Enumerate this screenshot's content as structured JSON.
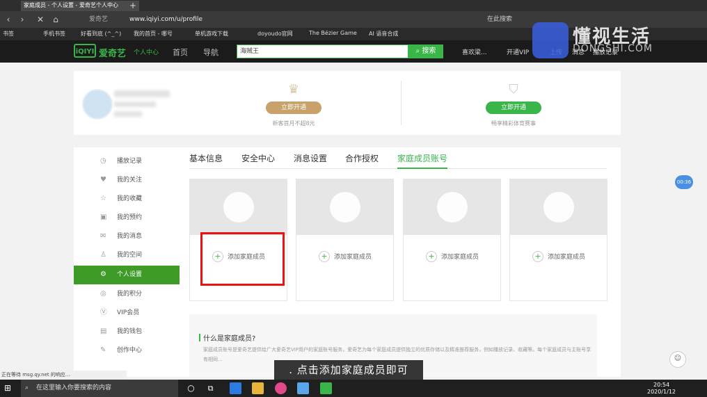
{
  "browser": {
    "tabs": [
      "家庭成员 - 个人设置 - 爱奇艺个人中心",
      "+"
    ],
    "url": "www.iqiyi.com/u/profile",
    "site_label": "爱奇艺",
    "right_label": "在此搜索",
    "bookmarks": [
      "书签",
      "手机书签",
      "好看到底 (^_^)",
      "我的首页 - 哪号",
      "单机游戏下载",
      "doyoudo官网",
      "The Bézier Game",
      "AI 语音合成"
    ]
  },
  "header": {
    "logo": "iQIYI",
    "brand": "爱奇艺",
    "sub": "个人中心",
    "nav": [
      "首页",
      "导航"
    ],
    "search_value": "海贼王",
    "search_button": "搜索",
    "right_items": [
      "喜欢梁...",
      "开通VIP",
      "上传",
      "消息",
      "播放记录"
    ]
  },
  "watermark": {
    "title": "懂视生活",
    "sub": "DONGSHI.COM"
  },
  "profile": {
    "vip": [
      {
        "button": "立即开通",
        "desc": "新客首月不超8元",
        "color": "#c8a16b"
      },
      {
        "button": "立即开通",
        "desc": "畅享精彩体育赛事",
        "color": "#3ab54a"
      }
    ]
  },
  "sidebar": {
    "items": [
      {
        "icon": "clock-icon",
        "glyph": "◷",
        "label": "播放记录"
      },
      {
        "icon": "follow-icon",
        "glyph": "♥",
        "label": "我的关注"
      },
      {
        "icon": "star-icon",
        "glyph": "☆",
        "label": "我的收藏"
      },
      {
        "icon": "calendar-icon",
        "glyph": "▣",
        "label": "我的预约"
      },
      {
        "icon": "mail-icon",
        "glyph": "✉",
        "label": "我的消息"
      },
      {
        "icon": "user-icon",
        "glyph": "♙",
        "label": "我的空间"
      },
      {
        "icon": "gear-icon",
        "glyph": "⚙",
        "label": "个人设置"
      },
      {
        "icon": "points-icon",
        "glyph": "◎",
        "label": "我的积分"
      },
      {
        "icon": "vip-icon",
        "glyph": "Ⓥ",
        "label": "VIP会员"
      },
      {
        "icon": "wallet-icon",
        "glyph": "▤",
        "label": "我的钱包"
      },
      {
        "icon": "create-icon",
        "glyph": "✎",
        "label": "创作中心"
      }
    ]
  },
  "tabs": [
    "基本信息",
    "安全中心",
    "消息设置",
    "合作授权",
    "家庭成员账号"
  ],
  "family_cards": [
    "添加家庭成员",
    "添加家庭成员",
    "添加家庭成员",
    "添加家庭成员"
  ],
  "faq": {
    "title": "什么是家庭成员?",
    "text": "家庭成员账号是爱奇艺提供给广大爱奇艺VIP用户的家庭账号服务，爱奇艺为每个家庭成员提供独立的优质存储以及精准推荐服务，例如播放记录、收藏等。每个家庭成员与主账号享有相同..."
  },
  "bubble": "00:36",
  "statusbar": "正在等待 msg.qy.net 的响应...",
  "caption": ". 点击添加家庭成员即可",
  "taskbar": {
    "search_placeholder": "在这里输入你要搜索的内容",
    "time": "20:54",
    "date": "2020/1/12"
  }
}
